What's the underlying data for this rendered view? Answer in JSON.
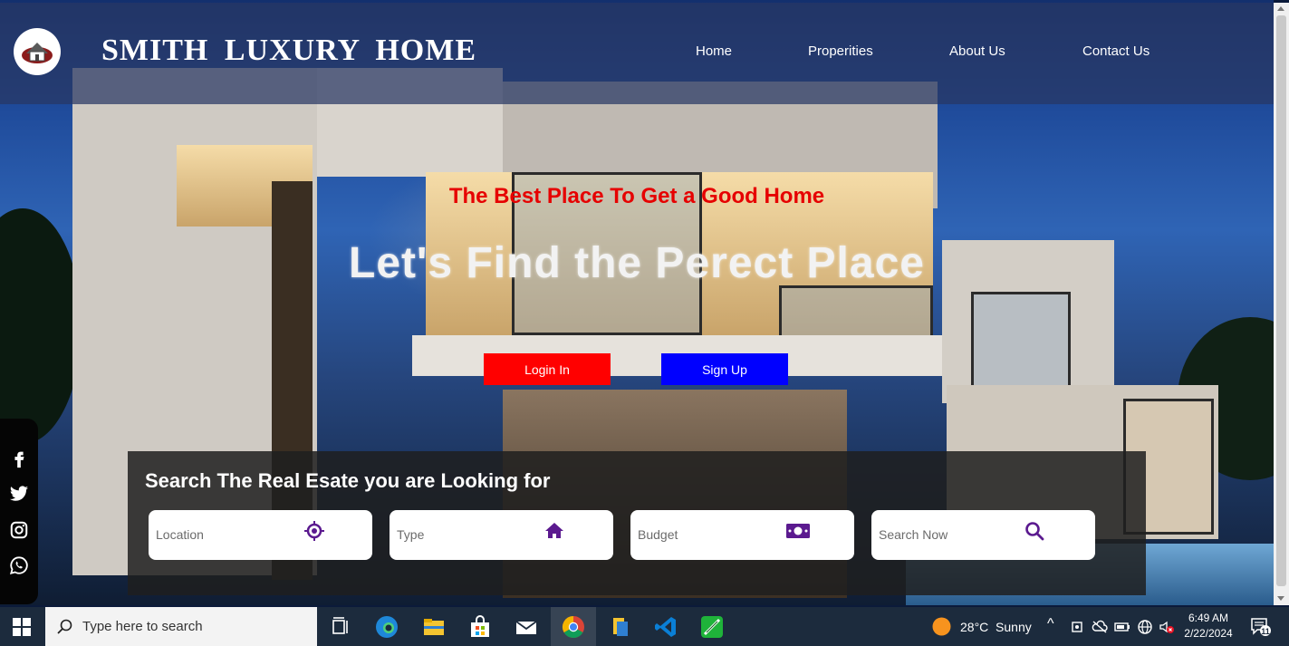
{
  "site": {
    "brand": "SMITH LUXURY HOME",
    "nav": [
      {
        "label": "Home"
      },
      {
        "label": "Properities"
      },
      {
        "label": "About Us"
      },
      {
        "label": "Contact Us"
      }
    ]
  },
  "hero": {
    "tagline": "The Best Place To Get a Good Home",
    "headline": "Let's Find the Perect Place",
    "login_label": "Login In",
    "signup_label": "Sign Up"
  },
  "social": {
    "icons": [
      "facebook-icon",
      "twitter-icon",
      "instagram-icon",
      "whatsapp-icon"
    ]
  },
  "search": {
    "title": "Search The Real Esate you are Looking for",
    "fields": [
      {
        "placeholder": "Location",
        "icon": "location-target-icon"
      },
      {
        "placeholder": "Type",
        "icon": "home-icon"
      },
      {
        "placeholder": "Budget",
        "icon": "money-bill-icon"
      },
      {
        "placeholder": "Search Now",
        "icon": "search-icon"
      }
    ],
    "icon_color": "#5b1a8f"
  },
  "colors": {
    "tagline": "#e60000",
    "login": "#ff0000",
    "signup": "#0000ff",
    "taskbar": "#1c2b3d"
  },
  "taskbar": {
    "search_placeholder": "Type here to search",
    "apps": [
      "task-view-icon",
      "edge-icon",
      "file-explorer-icon",
      "store-icon",
      "mail-icon",
      "chrome-icon",
      "files-icon",
      "vscode-icon",
      "app-icon"
    ],
    "weather": "28°C  Sunny",
    "time": "6:49 AM",
    "date": "2/22/2024",
    "notification_count": "11"
  }
}
